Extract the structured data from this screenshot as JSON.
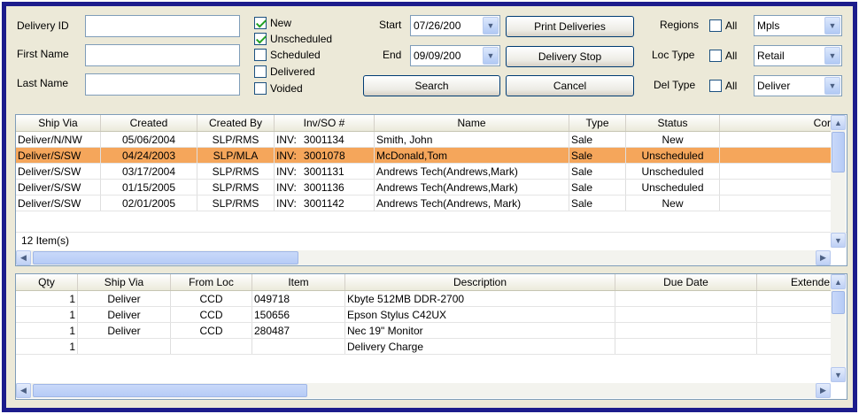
{
  "filters": {
    "delivery_id_label": "Delivery ID",
    "first_name_label": "First Name",
    "last_name_label": "Last Name",
    "delivery_id_value": "",
    "first_name_value": "",
    "last_name_value": ""
  },
  "status_checks": [
    {
      "label": "New",
      "checked": true
    },
    {
      "label": "Unscheduled",
      "checked": true
    },
    {
      "label": "Scheduled",
      "checked": false
    },
    {
      "label": "Delivered",
      "checked": false
    },
    {
      "label": "Voided",
      "checked": false
    }
  ],
  "dates": {
    "start_label": "Start",
    "start_value": "07/26/200",
    "end_label": "End",
    "end_value": "09/09/200"
  },
  "buttons": {
    "print": "Print Deliveries",
    "stop": "Delivery Stop",
    "search": "Search",
    "cancel": "Cancel"
  },
  "right_filters": {
    "regions_label": "Regions",
    "regions_all": "All",
    "regions_value": "Mpls",
    "loc_type_label": "Loc Type",
    "loc_type_all": "All",
    "loc_type_value": "Retail",
    "del_type_label": "Del Type",
    "del_type_all": "All",
    "del_type_value": "Deliver"
  },
  "deliveries": {
    "columns": [
      "Ship Via",
      "Created",
      "Created By",
      "Inv/SO #",
      "Name",
      "Type",
      "Status",
      "Cor"
    ],
    "rows": [
      {
        "ship_via": "Deliver/N/NW",
        "created": "05/06/2004",
        "created_by": "SLP/RMS",
        "inv_prefix": "INV:",
        "inv": "3001134",
        "name": "Smith, John",
        "type": "Sale",
        "status": "New",
        "cor": ""
      },
      {
        "ship_via": "Deliver/S/SW",
        "created": "04/24/2003",
        "created_by": "SLP/MLA",
        "inv_prefix": "INV:",
        "inv": "3001078",
        "name": "McDonald,Tom",
        "type": "Sale",
        "status": "Unscheduled",
        "cor": ""
      },
      {
        "ship_via": "Deliver/S/SW",
        "created": "03/17/2004",
        "created_by": "SLP/RMS",
        "inv_prefix": "INV:",
        "inv": "3001131",
        "name": "Andrews Tech(Andrews,Mark)",
        "type": "Sale",
        "status": "Unscheduled",
        "cor": ""
      },
      {
        "ship_via": "Deliver/S/SW",
        "created": "01/15/2005",
        "created_by": "SLP/RMS",
        "inv_prefix": "INV:",
        "inv": "3001136",
        "name": "Andrews Tech(Andrews,Mark)",
        "type": "Sale",
        "status": "Unscheduled",
        "cor": ""
      },
      {
        "ship_via": "Deliver/S/SW",
        "created": "02/01/2005",
        "created_by": "SLP/RMS",
        "inv_prefix": "INV:",
        "inv": "3001142",
        "name": "Andrews Tech(Andrews, Mark)",
        "type": "Sale",
        "status": "New",
        "cor": ""
      }
    ],
    "selected_index": 1,
    "count_text": "12 Item(s)"
  },
  "items": {
    "columns": [
      "Qty",
      "Ship Via",
      "From Loc",
      "Item",
      "Description",
      "Due Date",
      "Extende"
    ],
    "rows": [
      {
        "qty": "1",
        "ship_via": "Deliver",
        "from_loc": "CCD",
        "item": "049718",
        "description": "Kbyte 512MB DDR-2700",
        "due_date": "",
        "extended": ""
      },
      {
        "qty": "1",
        "ship_via": "Deliver",
        "from_loc": "CCD",
        "item": "150656",
        "description": "Epson Stylus C42UX",
        "due_date": "",
        "extended": ""
      },
      {
        "qty": "1",
        "ship_via": "Deliver",
        "from_loc": "CCD",
        "item": "280487",
        "description": "Nec 19\" Monitor",
        "due_date": "",
        "extended": ""
      },
      {
        "qty": "1",
        "ship_via": "",
        "from_loc": "",
        "item": "",
        "description": "Delivery Charge",
        "due_date": "",
        "extended": ""
      }
    ]
  },
  "colors": {
    "frame_border": "#1c1c8c",
    "window_bg": "#ece9d8",
    "selected_row": "#f5a65b",
    "input_border": "#7f9db9"
  },
  "icons": {
    "dropdown": "chevron-down-icon",
    "scroll_up": "scroll-up-icon",
    "scroll_down": "scroll-down-icon",
    "scroll_left": "scroll-left-icon",
    "scroll_right": "scroll-right-icon"
  }
}
